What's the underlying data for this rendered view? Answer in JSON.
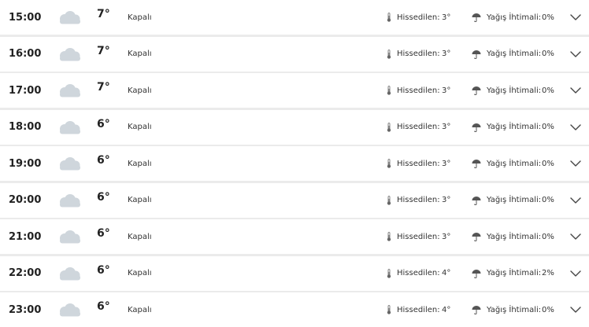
{
  "labels": {
    "feels_like": "Hissedilen:",
    "rain_chance": "Yağış İhtimali:"
  },
  "icons": {
    "weather": "cloud-icon",
    "feels_like": "thermometer-icon",
    "rain": "umbrella-icon",
    "expand": "chevron-down-icon"
  },
  "colors": {
    "cloud": "#cfd6dc",
    "row_bg": "#ffffff",
    "separator": "#ebebeb"
  },
  "hours": [
    {
      "time": "15:00",
      "temp": "7°",
      "condition": "Kapalı",
      "feels": "3°",
      "rain": "0%"
    },
    {
      "time": "16:00",
      "temp": "7°",
      "condition": "Kapalı",
      "feels": "3°",
      "rain": "0%"
    },
    {
      "time": "17:00",
      "temp": "7°",
      "condition": "Kapalı",
      "feels": "3°",
      "rain": "0%"
    },
    {
      "time": "18:00",
      "temp": "6°",
      "condition": "Kapalı",
      "feels": "3°",
      "rain": "0%"
    },
    {
      "time": "19:00",
      "temp": "6°",
      "condition": "Kapalı",
      "feels": "3°",
      "rain": "0%"
    },
    {
      "time": "20:00",
      "temp": "6°",
      "condition": "Kapalı",
      "feels": "3°",
      "rain": "0%"
    },
    {
      "time": "21:00",
      "temp": "6°",
      "condition": "Kapalı",
      "feels": "3°",
      "rain": "0%"
    },
    {
      "time": "22:00",
      "temp": "6°",
      "condition": "Kapalı",
      "feels": "4°",
      "rain": "2%"
    },
    {
      "time": "23:00",
      "temp": "6°",
      "condition": "Kapalı",
      "feels": "4°",
      "rain": "0%"
    }
  ]
}
